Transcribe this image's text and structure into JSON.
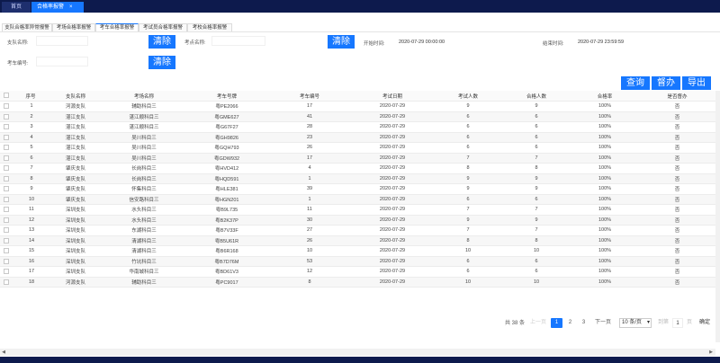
{
  "top_tabs": {
    "home": "首页",
    "active": "合格率报警",
    "close": "×"
  },
  "sub_tabs": [
    "支队合格率异常报警",
    "考场合格率报警",
    "考车合格率报警",
    "考试员合格率报警",
    "考校合格率报警"
  ],
  "filters": {
    "detachment_label": "支队名称:",
    "clear1": "清除",
    "site_label": "考点名称:",
    "clear2": "清除",
    "start_label": "开始时间:",
    "start_value": "2020-07-29 00:00:00",
    "end_label": "结束时间:",
    "end_value": "2020-07-29 23:59:59",
    "car_label": "考车编号:",
    "clear3": "清除"
  },
  "actions": {
    "query": "查询",
    "supervise": "督办",
    "export": "导出"
  },
  "table": {
    "headers": [
      "序号",
      "支队名称",
      "考场名称",
      "考车号牌",
      "考车编号",
      "考试日期",
      "考试人数",
      "合格人数",
      "合格率",
      "是否督办"
    ],
    "rows": [
      [
        "1",
        "河源支队",
        "辅助科目三",
        "粤PE2066",
        "17",
        "2020-07-29",
        "9",
        "9",
        "100%",
        "否"
      ],
      [
        "2",
        "湛江支队",
        "湛江顺科目三",
        "粤GME627",
        "41",
        "2020-07-29",
        "6",
        "6",
        "100%",
        "否"
      ],
      [
        "3",
        "湛江支队",
        "湛江顺科目三",
        "粤G67F27",
        "28",
        "2020-07-29",
        "6",
        "6",
        "100%",
        "否"
      ],
      [
        "4",
        "湛江支队",
        "吴川科目三",
        "粤GH9826",
        "23",
        "2020-07-29",
        "6",
        "6",
        "100%",
        "否"
      ],
      [
        "5",
        "湛江支队",
        "吴川科目三",
        "粤GQH793",
        "26",
        "2020-07-29",
        "6",
        "6",
        "100%",
        "否"
      ],
      [
        "6",
        "湛江支队",
        "吴川科目三",
        "粤GDW932",
        "17",
        "2020-07-29",
        "7",
        "7",
        "100%",
        "否"
      ],
      [
        "7",
        "肇庆支队",
        "长岗科目三",
        "粤HVD412",
        "4",
        "2020-07-29",
        "8",
        "8",
        "100%",
        "否"
      ],
      [
        "8",
        "肇庆支队",
        "长岗科目三",
        "粤HQD591",
        "1",
        "2020-07-29",
        "9",
        "9",
        "100%",
        "否"
      ],
      [
        "9",
        "肇庆支队",
        "怀集科目三",
        "粤HLE381",
        "39",
        "2020-07-29",
        "9",
        "9",
        "100%",
        "否"
      ],
      [
        "10",
        "肇庆支队",
        "信安路科目三",
        "粤HGN201",
        "1",
        "2020-07-29",
        "6",
        "6",
        "100%",
        "否"
      ],
      [
        "11",
        "深圳支队",
        "水头科目三",
        "粤B9L735",
        "11",
        "2020-07-29",
        "7",
        "7",
        "100%",
        "否"
      ],
      [
        "12",
        "深圳支队",
        "水头科目三",
        "粤B2K37P",
        "30",
        "2020-07-29",
        "9",
        "9",
        "100%",
        "否"
      ],
      [
        "13",
        "深圳支队",
        "东湖科目三",
        "粤B7V33F",
        "27",
        "2020-07-29",
        "7",
        "7",
        "100%",
        "否"
      ],
      [
        "14",
        "深圳支队",
        "清湖科目三",
        "粤B5U61R",
        "26",
        "2020-07-29",
        "8",
        "8",
        "100%",
        "否"
      ],
      [
        "15",
        "深圳支队",
        "清湖科目三",
        "粤B6R168",
        "10",
        "2020-07-29",
        "10",
        "10",
        "100%",
        "否"
      ],
      [
        "16",
        "深圳支队",
        "竹坑科目三",
        "粤B7D76M",
        "53",
        "2020-07-29",
        "6",
        "6",
        "100%",
        "否"
      ],
      [
        "17",
        "深圳支队",
        "华南城科目三",
        "粤BD61V3",
        "12",
        "2020-07-29",
        "6",
        "6",
        "100%",
        "否"
      ],
      [
        "18",
        "河源支队",
        "辅助科目三",
        "粤PC9017",
        "8",
        "2020-07-29",
        "10",
        "10",
        "100%",
        "否"
      ]
    ]
  },
  "pagination": {
    "total": "共 38 条",
    "prev": "上一页",
    "pages": [
      "1",
      "2",
      "3"
    ],
    "next": "下一页",
    "page_size": "10 条/页",
    "goto_label": "到第",
    "goto_value": "1",
    "page_unit": "页",
    "confirm": "确定"
  },
  "colors": {
    "accent": "#1677ff",
    "topbar": "#0d1a4d"
  }
}
